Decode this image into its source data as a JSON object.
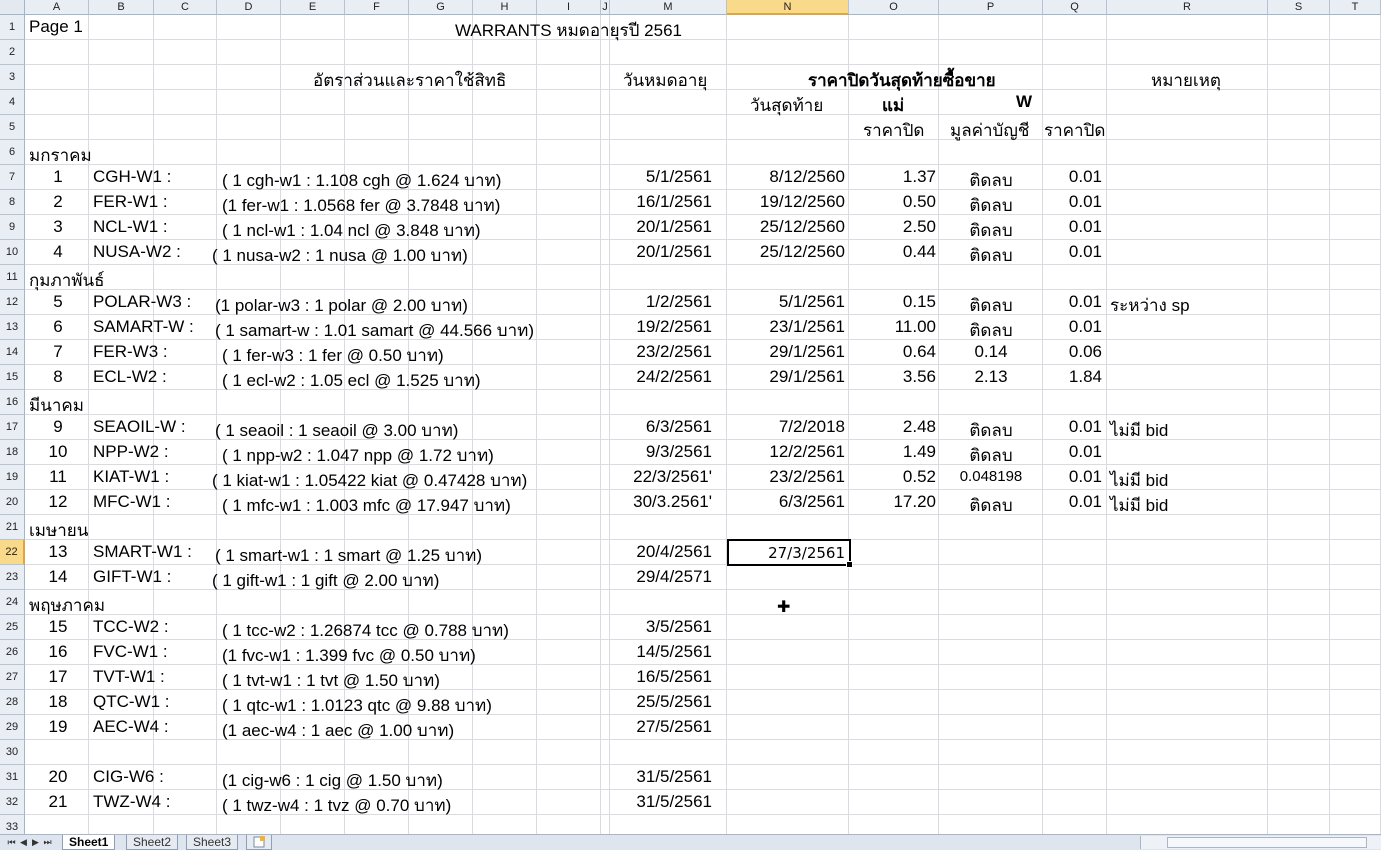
{
  "columns": [
    "A",
    "B",
    "C",
    "D",
    "E",
    "F",
    "G",
    "H",
    "I",
    "J",
    "M",
    "N",
    "O",
    "P",
    "Q",
    "R",
    "S",
    "T"
  ],
  "active_column": "N",
  "active_row": "22",
  "rows": [
    "1",
    "2",
    "3",
    "4",
    "5",
    "6",
    "7",
    "8",
    "9",
    "10",
    "11",
    "12",
    "13",
    "14",
    "15",
    "16",
    "17",
    "18",
    "19",
    "20",
    "21",
    "22",
    "23",
    "24",
    "25",
    "26",
    "27",
    "28",
    "29",
    "30",
    "31",
    "32",
    "33"
  ],
  "title": {
    "page": "Page 1",
    "main": "WARRANTS หมดอายุรปี 2561"
  },
  "headers": {
    "ratio": "อัตราส่วนและราคาใช้สิทธิ",
    "expiry": "วันหมดอายุ",
    "last_close": "ราคาปิดวันสุดท้ายซื้อขาย",
    "remark": "หมายเหตุ",
    "last_day": "วันสุดท้าย",
    "mother": "แม่",
    "w": "W",
    "close_price": "ราคาปิด",
    "book_value": "มูลค่าบัญชี",
    "w_close": "ราคาปิด"
  },
  "months": [
    {
      "row": 6,
      "label": "มกราคม"
    },
    {
      "row": 11,
      "label": "กุมภาพันธ์"
    },
    {
      "row": 16,
      "label": "มีนาคม"
    },
    {
      "row": 21,
      "label": "เมษายน"
    },
    {
      "row": 24,
      "label": "พฤษภาคม"
    }
  ],
  "warrants": [
    {
      "row": 7,
      "no": "1",
      "code": "CGH-W1 :",
      "ratio": "( 1 cgh-w1 : 1.108 cgh  @ 1.624 บาท)",
      "expiry": "5/1/2561",
      "last_day": "8/12/2560",
      "mother": "1.37",
      "book": "ติดลบ",
      "close": "0.01",
      "remark": ""
    },
    {
      "row": 8,
      "no": "2",
      "code": "FER-W1 :",
      "ratio": "(1 fer-w1 : 1.0568 fer @ 3.7848 บาท)",
      "expiry": "16/1/2561",
      "last_day": "19/12/2560",
      "mother": "0.50",
      "book": "ติดลบ",
      "close": "0.01",
      "remark": ""
    },
    {
      "row": 9,
      "no": "3",
      "code": "NCL-W1 :",
      "ratio": "( 1 ncl-w1 : 1.04 ncl  @ 3.848 บาท)",
      "expiry": "20/1/2561",
      "last_day": "25/12/2560",
      "mother": "2.50",
      "book": "ติดลบ",
      "close": "0.01",
      "remark": ""
    },
    {
      "row": 10,
      "no": "4",
      "code": "NUSA-W2 :",
      "ratio": "( 1 nusa-w2 : 1 nusa @ 1.00 บาท)",
      "expiry": "20/1/2561",
      "last_day": "25/12/2560",
      "mother": "0.44",
      "book": "ติดลบ",
      "close": "0.01",
      "remark": ""
    },
    {
      "row": 12,
      "no": "5",
      "code": "POLAR-W3 :",
      "ratio": "(1 polar-w3 : 1 polar @ 2.00 บาท)",
      "expiry": "1/2/2561",
      "last_day": "5/1/2561",
      "mother": "0.15",
      "book": "ติดลบ",
      "close": "0.01",
      "remark": "ระหว่าง sp"
    },
    {
      "row": 13,
      "no": "6",
      "code": "SAMART-W :",
      "ratio": "( 1 samart-w : 1.01 samart  @ 44.566 บาท)",
      "expiry": "19/2/2561",
      "last_day": "23/1/2561",
      "mother": "11.00",
      "book": "ติดลบ",
      "close": "0.01",
      "remark": ""
    },
    {
      "row": 14,
      "no": "7",
      "code": "FER-W3 :",
      "ratio": "( 1 fer-w3 : 1 fer @ 0.50 บาท)",
      "expiry": "23/2/2561",
      "last_day": "29/1/2561",
      "mother": "0.64",
      "book": "0.14",
      "close": "0.06",
      "remark": ""
    },
    {
      "row": 15,
      "no": "8",
      "code": "ECL-W2 :",
      "ratio": "( 1 ecl-w2 : 1.05 ecl @ 1.525 บาท)",
      "expiry": "24/2/2561",
      "last_day": "29/1/2561",
      "mother": "3.56",
      "book": "2.13",
      "close": "1.84",
      "remark": ""
    },
    {
      "row": 17,
      "no": "9",
      "code": "SEAOIL-W :",
      "ratio": "( 1 seaoil : 1 seaoil @ 3.00 บาท)",
      "expiry": "6/3/2561",
      "last_day": "7/2/2018",
      "mother": "2.48",
      "book": "ติดลบ",
      "close": "0.01",
      "remark": "ไม่มี bid"
    },
    {
      "row": 18,
      "no": "10",
      "code": "NPP-W2 :",
      "ratio": "( 1 npp-w2 : 1.047 npp @ 1.72 บาท)",
      "expiry": "9/3/2561",
      "last_day": "12/2/2561",
      "mother": "1.49",
      "book": "ติดลบ",
      "close": "0.01",
      "remark": ""
    },
    {
      "row": 19,
      "no": "11",
      "code": "KIAT-W1 :",
      "ratio": "( 1 kiat-w1 : 1.05422 kiat @ 0.47428 บาท)",
      "expiry": "22/3/2561'",
      "last_day": "23/2/2561",
      "mother": "0.52",
      "book": "0.048198",
      "close": "0.01",
      "remark": "ไม่มี   bid"
    },
    {
      "row": 20,
      "no": "12",
      "code": "MFC-W1 :",
      "ratio": "( 1 mfc-w1 : 1.003 mfc @ 17.947 บาท)",
      "expiry": "30/3.2561'",
      "last_day": "6/3/2561",
      "mother": "17.20",
      "book": "ติดลบ",
      "close": "0.01",
      "remark": "ไม่มี bid"
    },
    {
      "row": 22,
      "no": "13",
      "code": "SMART-W1 :",
      "ratio": "( 1 smart-w1 : 1 smart @ 1.25 บาท)",
      "expiry": "20/4/2561",
      "last_day": "27/3/2561",
      "mother": "",
      "book": "",
      "close": "",
      "remark": ""
    },
    {
      "row": 23,
      "no": "14",
      "code": "GIFT-W1 :",
      "ratio": "( 1 gift-w1 : 1 gift @ 2.00 บาท)",
      "expiry": "29/4/2571",
      "last_day": "",
      "mother": "",
      "book": "",
      "close": "",
      "remark": ""
    },
    {
      "row": 25,
      "no": "15",
      "code": "TCC-W2 :",
      "ratio": "( 1 tcc-w2 : 1.26874 tcc @ 0.788 บาท)",
      "expiry": "3/5/2561",
      "last_day": "",
      "mother": "",
      "book": "",
      "close": "",
      "remark": ""
    },
    {
      "row": 26,
      "no": "16",
      "code": "FVC-W1 :",
      "ratio": "(1 fvc-w1 : 1.399 fvc @ 0.50 บาท)",
      "expiry": "14/5/2561",
      "last_day": "",
      "mother": "",
      "book": "",
      "close": "",
      "remark": ""
    },
    {
      "row": 27,
      "no": "17",
      "code": "TVT-W1 :",
      "ratio": "( 1 tvt-w1 : 1 tvt  @ 1.50 บาท)",
      "expiry": "16/5/2561",
      "last_day": "",
      "mother": "",
      "book": "",
      "close": "",
      "remark": ""
    },
    {
      "row": 28,
      "no": "18",
      "code": "QTC-W1 :",
      "ratio": "( 1 qtc-w1 : 1.0123 qtc @ 9.88 บาท)",
      "expiry": "25/5/2561",
      "last_day": "",
      "mother": "",
      "book": "",
      "close": "",
      "remark": ""
    },
    {
      "row": 29,
      "no": "19",
      "code": "AEC-W4 :",
      "ratio": "(1 aec-w4 : 1 aec @ 1.00 บาท)",
      "expiry": "27/5/2561",
      "last_day": "",
      "mother": "",
      "book": "",
      "close": "",
      "remark": ""
    },
    {
      "row": 31,
      "no": "20",
      "code": "CIG-W6 :",
      "ratio": "(1 cig-w6 : 1 cig @ 1.50 บาท)",
      "expiry": "31/5/2561",
      "last_day": "",
      "mother": "",
      "book": "",
      "close": "",
      "remark": ""
    },
    {
      "row": 32,
      "no": "21",
      "code": "TWZ-W4 :",
      "ratio": "( 1 twz-w4 :  1 tvz  @ 0.70 บาท)",
      "expiry": "31/5/2561",
      "last_day": "",
      "mother": "",
      "book": "",
      "close": "",
      "remark": ""
    }
  ],
  "selected_cell": {
    "ref": "N22",
    "value": "27/3/2561"
  },
  "tabs": [
    {
      "label": "Sheet1",
      "active": true
    },
    {
      "label": "Sheet2",
      "active": false
    },
    {
      "label": "Sheet3",
      "active": false
    }
  ],
  "nav": {
    "first": "⏮",
    "prev": "◀",
    "next": "▶",
    "last": "⏭"
  },
  "new_sheet_icon": "insert-worksheet-icon",
  "colors": {
    "header_bg": "#e9eef5",
    "active_header": "#f9d98a",
    "gridline": "#d8dce2"
  }
}
